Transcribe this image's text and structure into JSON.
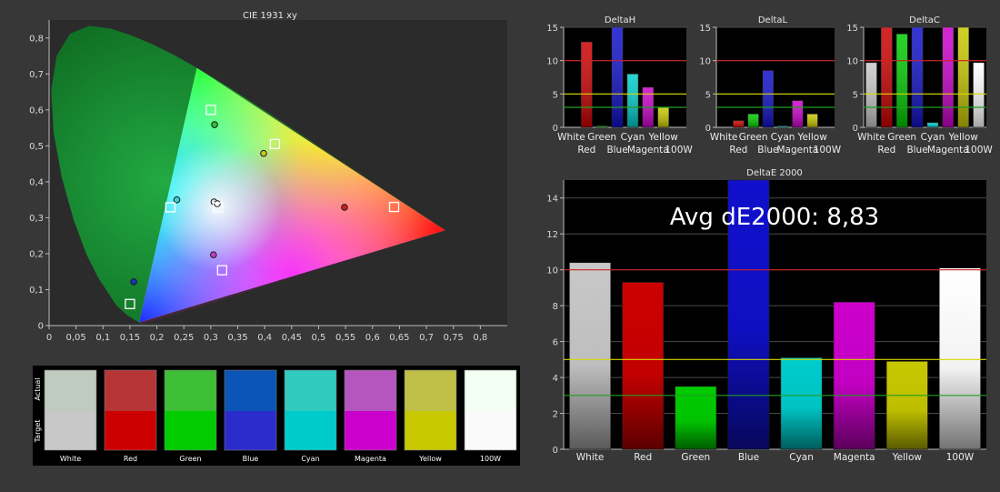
{
  "chart_data": [
    {
      "id": "cie",
      "type": "scatter",
      "title": "CIE 1931 xy",
      "xlim": [
        0,
        0.85
      ],
      "ylim": [
        0,
        0.85
      ],
      "xticks": [
        0,
        0.05,
        0.1,
        0.15,
        0.2,
        0.25,
        0.3,
        0.35,
        0.4,
        0.45,
        0.5,
        0.55,
        0.6,
        0.65,
        0.7,
        0.75,
        0.8
      ],
      "xtick_labels": [
        "0",
        "0,05",
        "0,1",
        "0,15",
        "0,2",
        "0,25",
        "0,3",
        "0,35",
        "0,4",
        "0,45",
        "0,5",
        "0,55",
        "0,6",
        "0,65",
        "0,7",
        "0,75",
        "0,8"
      ],
      "yticks": [
        0,
        0.1,
        0.2,
        0.3,
        0.4,
        0.5,
        0.6,
        0.7,
        0.8
      ],
      "ytick_labels": [
        "0",
        "0,1",
        "0,2",
        "0,3",
        "0,4",
        "0,5",
        "0,6",
        "0,7",
        "0,8"
      ],
      "gamut_triangle": [
        [
          0.735,
          0.265
        ],
        [
          0.274,
          0.717
        ],
        [
          0.167,
          0.009
        ]
      ],
      "target_points": [
        {
          "x": 0.64,
          "y": 0.33
        },
        {
          "x": 0.3,
          "y": 0.6
        },
        {
          "x": 0.15,
          "y": 0.06
        },
        {
          "x": 0.225,
          "y": 0.329
        },
        {
          "x": 0.321,
          "y": 0.154
        },
        {
          "x": 0.419,
          "y": 0.505
        },
        {
          "x": 0.313,
          "y": 0.329
        }
      ],
      "actual_points": [
        {
          "x": 0.548,
          "y": 0.329,
          "color": "#cc2020"
        },
        {
          "x": 0.307,
          "y": 0.559,
          "color": "#30c030"
        },
        {
          "x": 0.157,
          "y": 0.122,
          "color": "#2030c0"
        },
        {
          "x": 0.237,
          "y": 0.35,
          "color": "#40d0d0"
        },
        {
          "x": 0.305,
          "y": 0.197,
          "color": "#c040c0"
        },
        {
          "x": 0.398,
          "y": 0.479,
          "color": "#c8c820"
        },
        {
          "x": 0.306,
          "y": 0.344,
          "color": "#e0e0e0"
        },
        {
          "x": 0.312,
          "y": 0.339,
          "color": "#ffffff"
        }
      ]
    },
    {
      "id": "deltaH",
      "type": "bar",
      "title": "DeltaH",
      "ylim": [
        0,
        15
      ],
      "yticks": [
        0,
        5,
        10,
        15
      ],
      "categories": [
        "White",
        "Red",
        "Green",
        "Blue",
        "Cyan",
        "Magenta",
        "Yellow",
        "100W"
      ],
      "values": [
        0,
        12.8,
        0.2,
        15,
        8,
        6,
        3,
        0
      ],
      "reference_lines": [
        10,
        5,
        3
      ]
    },
    {
      "id": "deltaL",
      "type": "bar",
      "title": "DeltaL",
      "ylim": [
        0,
        15
      ],
      "yticks": [
        0,
        5,
        10,
        15
      ],
      "categories": [
        "White",
        "Red",
        "Green",
        "Blue",
        "Cyan",
        "Magenta",
        "Yellow",
        "100W"
      ],
      "values": [
        0,
        1,
        2,
        8.5,
        0.2,
        4,
        2,
        0
      ],
      "reference_lines": [
        10,
        5,
        3
      ]
    },
    {
      "id": "deltaC",
      "type": "bar",
      "title": "DeltaC",
      "ylim": [
        0,
        15
      ],
      "yticks": [
        0,
        5,
        10,
        15
      ],
      "categories": [
        "White",
        "Red",
        "Green",
        "Blue",
        "Cyan",
        "Magenta",
        "Yellow",
        "100W"
      ],
      "values": [
        9.7,
        15,
        14,
        15,
        0.7,
        15,
        15,
        9.7
      ],
      "reference_lines": [
        10,
        5,
        3
      ]
    },
    {
      "id": "deltaE",
      "type": "bar",
      "title": "DeltaE 2000",
      "ylim": [
        0,
        15
      ],
      "yticks": [
        0,
        2,
        4,
        6,
        8,
        10,
        12,
        14
      ],
      "categories": [
        "White",
        "Red",
        "Green",
        "Blue",
        "Cyan",
        "Magenta",
        "Yellow",
        "100W"
      ],
      "values": [
        10.4,
        9.3,
        3.5,
        15,
        5.1,
        8.2,
        4.9,
        10.1
      ],
      "reference_lines": [
        10,
        5,
        3
      ],
      "annotation": "Avg dE2000: 8,83"
    }
  ],
  "bar_colors": [
    "#c8c8c8",
    "#cc0000",
    "#00cc00",
    "#1010cc",
    "#00cccc",
    "#cc00cc",
    "#c8c800",
    "#ffffff"
  ],
  "reference_line_colors": [
    "#d02020",
    "#d8d800",
    "#20a020"
  ],
  "swatches": {
    "side_labels": {
      "actual": "Actual",
      "target": "Target"
    },
    "items": [
      {
        "label": "White",
        "actual": "#bfcbbf",
        "target": "#c8c8c8"
      },
      {
        "label": "Red",
        "actual": "#b73537",
        "target": "#cc0000"
      },
      {
        "label": "Green",
        "actual": "#3ebf35",
        "target": "#00cc00"
      },
      {
        "label": "Blue",
        "actual": "#0a55b5",
        "target": "#2c2ccc"
      },
      {
        "label": "Cyan",
        "actual": "#2fcbbf",
        "target": "#00cbcb"
      },
      {
        "label": "Magenta",
        "actual": "#b456be",
        "target": "#cc00cc"
      },
      {
        "label": "Yellow",
        "actual": "#c0c049",
        "target": "#c8c800"
      },
      {
        "label": "100W",
        "actual": "#f2fff2",
        "target": "#fafafa"
      }
    ]
  }
}
